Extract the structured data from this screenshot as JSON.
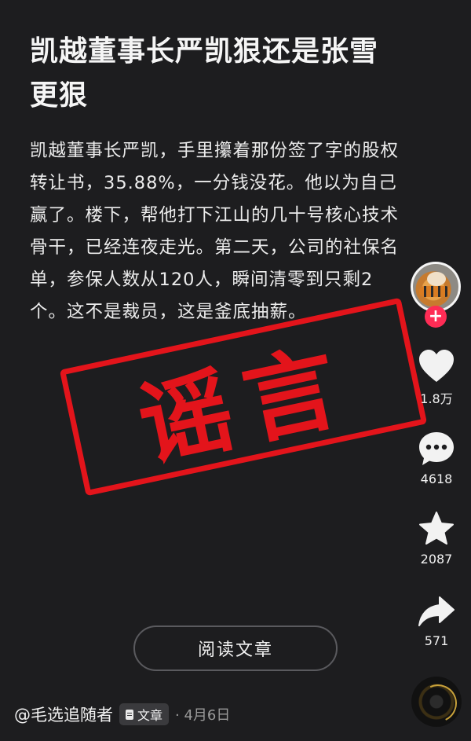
{
  "post": {
    "title": "凯越董事长严凯狠还是张雪更狠",
    "body": "凯越董事长严凯，手里攥着那份签了字的股权转让书，35.88%，一分钱没花。他以为自己赢了。楼下，帮他打下江山的几十号核心技术骨干，已经连夜走光。第二天，公司的社保名单，参保人数从120人，瞬间清零到只剩2个。这不是裁员，这是釜底抽薪。",
    "stamp_text": "谣言",
    "read_button": "阅读文章"
  },
  "footer": {
    "author": "@毛选追随者",
    "tag_label": "文章",
    "date": "· 4月6日"
  },
  "actions": {
    "like_count": "1.8万",
    "comment_count": "4618",
    "favorite_count": "2087",
    "share_count": "571",
    "follow_symbol": "+"
  },
  "colors": {
    "background": "#1d1d1f",
    "stamp": "#e3141b",
    "follow": "#fe2c55"
  },
  "icons": [
    "heart-icon",
    "comment-icon",
    "star-icon",
    "share-icon",
    "document-icon"
  ]
}
